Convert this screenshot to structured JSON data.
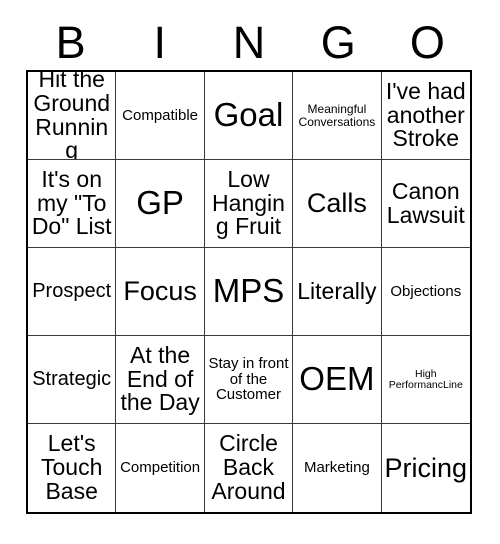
{
  "header": {
    "letters": [
      "B",
      "I",
      "N",
      "G",
      "O"
    ]
  },
  "grid": {
    "rows": 5,
    "columns": 5,
    "border_color": "#000000",
    "line_color": "#3a3a3a",
    "background": "#ffffff",
    "text_color": "#000000",
    "cells": [
      {
        "text": "Hit the Ground Running",
        "size": "lg"
      },
      {
        "text": "Compatible",
        "size": "sm"
      },
      {
        "text": "Goal",
        "size": "xxl"
      },
      {
        "text": "Meaningful Conversations",
        "size": "xs"
      },
      {
        "text": "I've had another Stroke",
        "size": "lg"
      },
      {
        "text": "It's on my \"To Do\" List",
        "size": "lg"
      },
      {
        "text": "GP",
        "size": "xxl"
      },
      {
        "text": "Low Hanging Fruit",
        "size": "lg"
      },
      {
        "text": "Calls",
        "size": "xl"
      },
      {
        "text": "Canon Lawsuit",
        "size": "lg"
      },
      {
        "text": "Prospect",
        "size": "md"
      },
      {
        "text": "Focus",
        "size": "xl"
      },
      {
        "text": "MPS",
        "size": "xxl"
      },
      {
        "text": "Literally",
        "size": "lg"
      },
      {
        "text": "Objections",
        "size": "sm"
      },
      {
        "text": "Strategic",
        "size": "md"
      },
      {
        "text": "At the End of the Day",
        "size": "lg"
      },
      {
        "text": "Stay in front of the Customer",
        "size": "sm"
      },
      {
        "text": "OEM",
        "size": "xxl"
      },
      {
        "text": "High PerformancLine",
        "size": "xxs"
      },
      {
        "text": "Let's Touch Base",
        "size": "lg"
      },
      {
        "text": "Competition",
        "size": "sm"
      },
      {
        "text": "Circle Back Around",
        "size": "lg"
      },
      {
        "text": "Marketing",
        "size": "sm"
      },
      {
        "text": "Pricing",
        "size": "xl"
      }
    ]
  }
}
